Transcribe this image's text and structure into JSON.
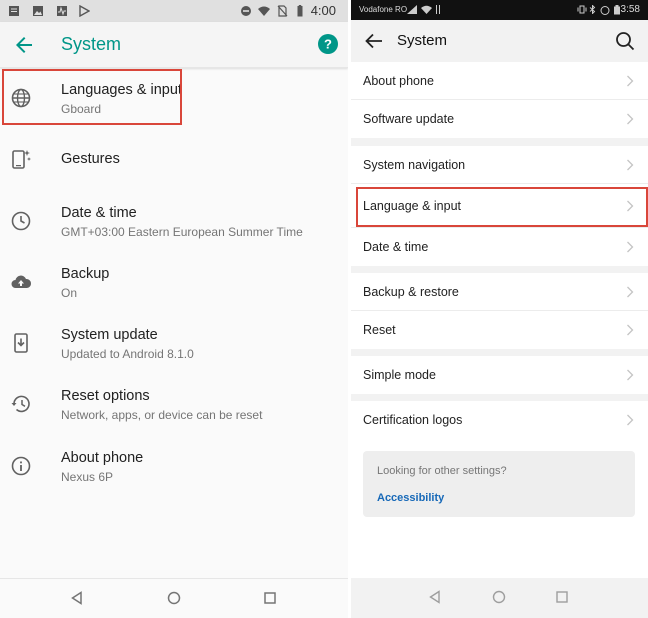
{
  "left": {
    "status": {
      "time": "4:00"
    },
    "appbar": {
      "title": "System"
    },
    "items": [
      {
        "title": "Languages & input",
        "subtitle": "Gboard",
        "icon": "globe-icon"
      },
      {
        "title": "Gestures",
        "subtitle": "",
        "icon": "gestures-icon"
      },
      {
        "title": "Date & time",
        "subtitle": "GMT+03:00 Eastern European Summer Time",
        "icon": "clock-icon"
      },
      {
        "title": "Backup",
        "subtitle": "On",
        "icon": "cloud-upload-icon"
      },
      {
        "title": "System update",
        "subtitle": "Updated to Android 8.1.0",
        "icon": "system-update-icon"
      },
      {
        "title": "Reset options",
        "subtitle": "Network, apps, or device can be reset",
        "icon": "history-icon"
      },
      {
        "title": "About phone",
        "subtitle": "Nexus 6P",
        "icon": "info-icon"
      }
    ],
    "colors": {
      "accent": "#009688",
      "highlight": "#d9463a"
    }
  },
  "right": {
    "status": {
      "carrier": "Vodafone RO",
      "time": "3:58"
    },
    "appbar": {
      "title": "System"
    },
    "groups": [
      [
        "About phone",
        "Software update"
      ],
      [
        "System navigation",
        "Language & input",
        "Date & time"
      ],
      [
        "Backup & restore",
        "Reset"
      ],
      [
        "Simple mode"
      ],
      [
        "Certification logos"
      ]
    ],
    "card": {
      "question": "Looking for other settings?",
      "link": "Accessibility"
    },
    "colors": {
      "link": "#1769b8",
      "highlight": "#d9463a"
    }
  }
}
